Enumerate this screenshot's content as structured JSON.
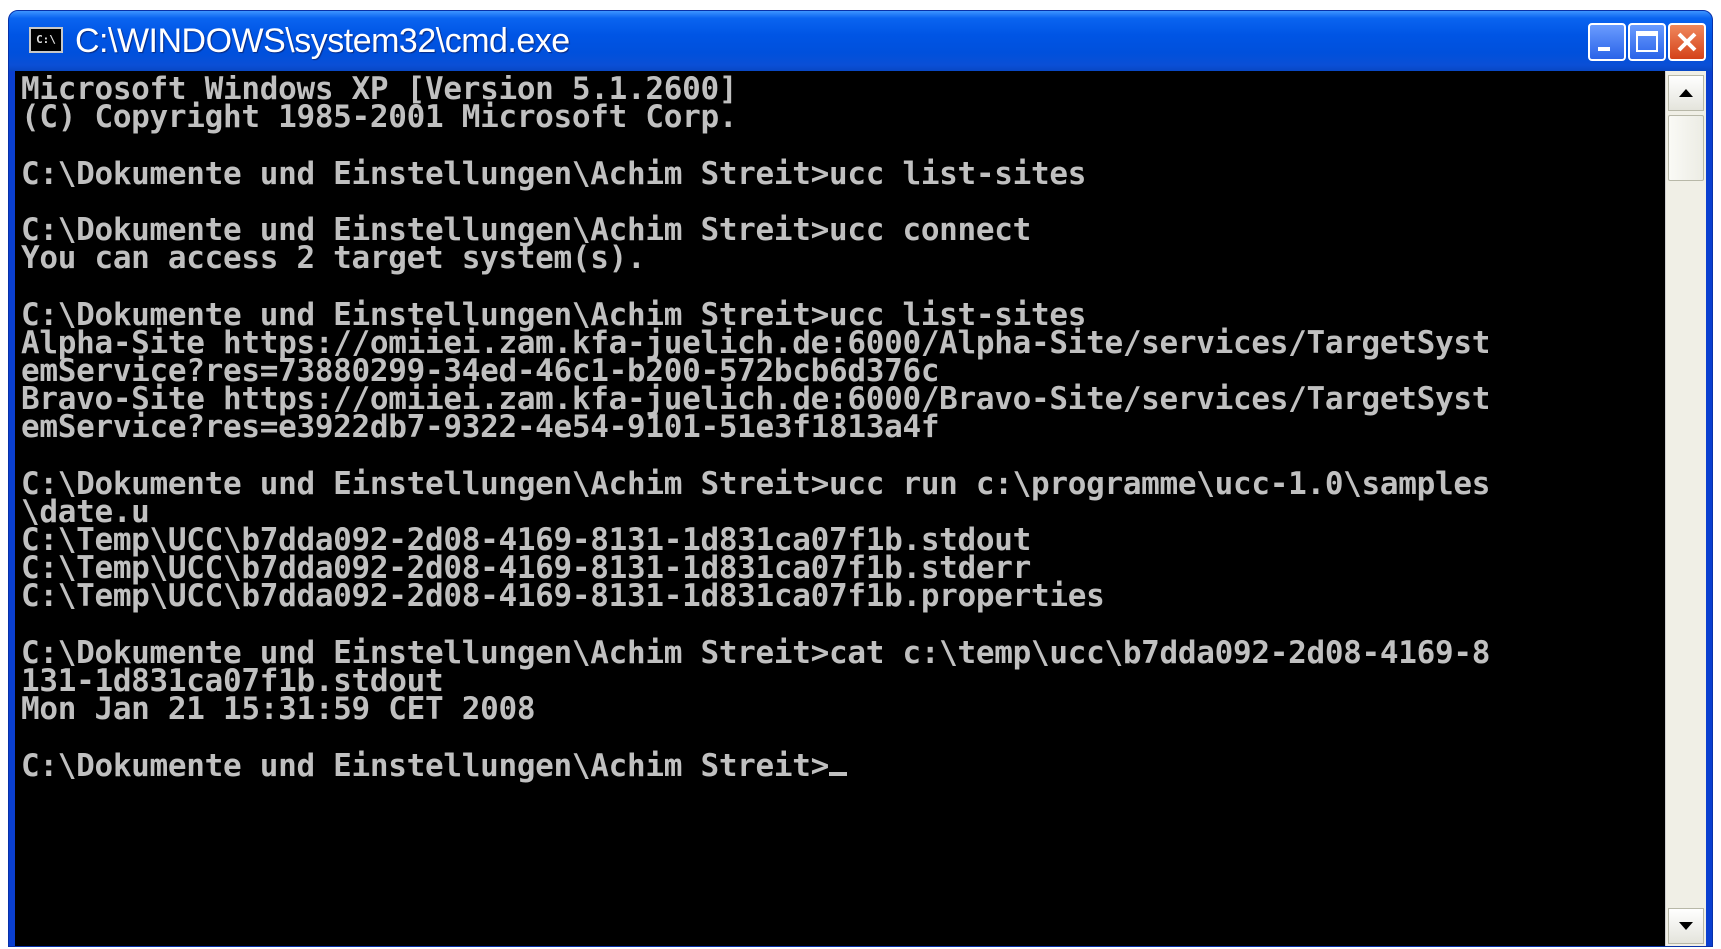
{
  "window": {
    "title": "C:\\WINDOWS\\system32\\cmd.exe",
    "icon": "console-icon",
    "icon_text": "C:\\"
  },
  "terminal": {
    "lines": [
      "Microsoft Windows XP [Version 5.1.2600]",
      "(C) Copyright 1985-2001 Microsoft Corp.",
      "",
      "C:\\Dokumente und Einstellungen\\Achim Streit>ucc list-sites",
      "",
      "C:\\Dokumente und Einstellungen\\Achim Streit>ucc connect",
      "You can access 2 target system(s).",
      "",
      "C:\\Dokumente und Einstellungen\\Achim Streit>ucc list-sites",
      "Alpha-Site https://omiiei.zam.kfa-juelich.de:6000/Alpha-Site/services/TargetSyst",
      "emService?res=73880299-34ed-46c1-b200-572bcb6d376c",
      "Bravo-Site https://omiiei.zam.kfa-juelich.de:6000/Bravo-Site/services/TargetSyst",
      "emService?res=e3922db7-9322-4e54-9101-51e3f1813a4f",
      "",
      "C:\\Dokumente und Einstellungen\\Achim Streit>ucc run c:\\programme\\ucc-1.0\\samples",
      "\\date.u",
      "C:\\Temp\\UCC\\b7dda092-2d08-4169-8131-1d831ca07f1b.stdout",
      "C:\\Temp\\UCC\\b7dda092-2d08-4169-8131-1d831ca07f1b.stderr",
      "C:\\Temp\\UCC\\b7dda092-2d08-4169-8131-1d831ca07f1b.properties",
      "",
      "C:\\Dokumente und Einstellungen\\Achim Streit>cat c:\\temp\\ucc\\b7dda092-2d08-4169-8",
      "131-1d831ca07f1b.stdout",
      "Mon Jan 21 15:31:59 CET 2008",
      ""
    ],
    "prompt": "C:\\Dokumente und Einstellungen\\Achim Streit>"
  },
  "colors": {
    "title_bar": "#0055e5",
    "console_bg": "#000000",
    "console_fg": "#c0c0c0",
    "close_button": "#d4421a"
  }
}
